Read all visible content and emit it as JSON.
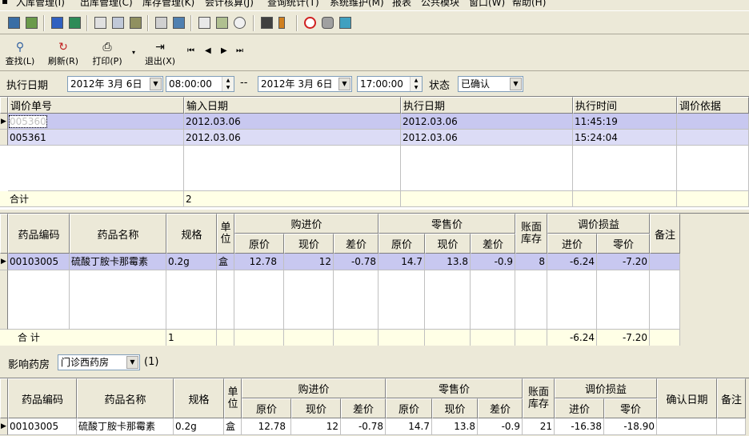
{
  "menu": [
    "入库管理(I)",
    "出库管理(C)",
    "库存管理(K)",
    "会计核算(J)",
    "查询统计(T)",
    "系统维护(M)",
    "报表",
    "公共模块",
    "窗口(W)",
    "帮助(H)"
  ],
  "toolbar_icons": [
    "open-icon",
    "save-icon",
    "report-icon",
    "check-icon",
    "clipboard-icon",
    "calendar-icon",
    "book-icon",
    "copy-icon",
    "table-icon",
    "calculator-icon",
    "print-preview-icon",
    "zoom-icon",
    "car-icon",
    "thermometer-icon",
    "stop-icon",
    "eraser-icon",
    "window-icon"
  ],
  "toolbar": {
    "find": "查找(L)",
    "refresh": "刷新(R)",
    "print": "打印(P)",
    "exit": "退出(X)",
    "first": "⏮",
    "prev": "◀",
    "next": "▶",
    "last": "⏭"
  },
  "filter": {
    "exec_date_label": "执行日期",
    "date_from": "2012年 3月 6日",
    "time_from": "08:00:00",
    "dash": "--",
    "date_to": "2012年 3月 6日",
    "time_to": "17:00:00",
    "status_label": "状态",
    "status_value": "已确认"
  },
  "grid1": {
    "headers": [
      "调价单号",
      "输入日期",
      "执行日期",
      "执行时间",
      "调价依据"
    ],
    "rows": [
      [
        "005360",
        "2012.03.06",
        "2012.03.06",
        "11:45:19",
        ""
      ],
      [
        "005361",
        "2012.03.06",
        "2012.03.06",
        "15:24:04",
        ""
      ]
    ],
    "total_label": "合计",
    "total_count": "2"
  },
  "grid2": {
    "headers": {
      "code": "药品编码",
      "name": "药品名称",
      "spec": "规格",
      "unit": "单位",
      "purchase": "购进价",
      "retail": "零售价",
      "orig": "原价",
      "now": "现价",
      "diff": "差价",
      "stock": "账面库存",
      "gain": "调价损益",
      "gain_in": "进价",
      "gain_retail": "零价",
      "remark": "备注"
    },
    "rows": [
      {
        "code": "00103005",
        "name": "硫酸丁胺卡那霉素",
        "spec": "0.2g",
        "unit": "盒",
        "p_orig": "12.78",
        "p_now": "12",
        "p_diff": "-0.78",
        "r_orig": "14.7",
        "r_now": "13.8",
        "r_diff": "-0.9",
        "stock": "8",
        "g_in": "-6.24",
        "g_retail": "-7.20",
        "remark": ""
      }
    ],
    "total_label": "合  计",
    "total_count": "1",
    "total_in": "-6.24",
    "total_retail": "-7.20"
  },
  "pharmacy": {
    "label": "影响药房",
    "value": "门诊西药房",
    "count": "(1)"
  },
  "grid3": {
    "headers": {
      "code": "药品编码",
      "name": "药品名称",
      "spec": "规格",
      "unit": "单位",
      "purchase": "购进价",
      "retail": "零售价",
      "orig": "原价",
      "now": "现价",
      "diff": "差价",
      "stock": "账面库存",
      "gain": "调价损益",
      "gain_in": "进价",
      "gain_retail": "零价",
      "confirm": "确认日期",
      "remark": "备注"
    },
    "rows": [
      {
        "code": "00103005",
        "name": "硫酸丁胺卡那霉素",
        "spec": "0.2g",
        "unit": "盒",
        "p_orig": "12.78",
        "p_now": "12",
        "p_diff": "-0.78",
        "r_orig": "14.7",
        "r_now": "13.8",
        "r_diff": "-0.9",
        "stock": "21",
        "g_in": "-16.38",
        "g_retail": "-18.90",
        "confirm": "",
        "remark": ""
      }
    ]
  }
}
